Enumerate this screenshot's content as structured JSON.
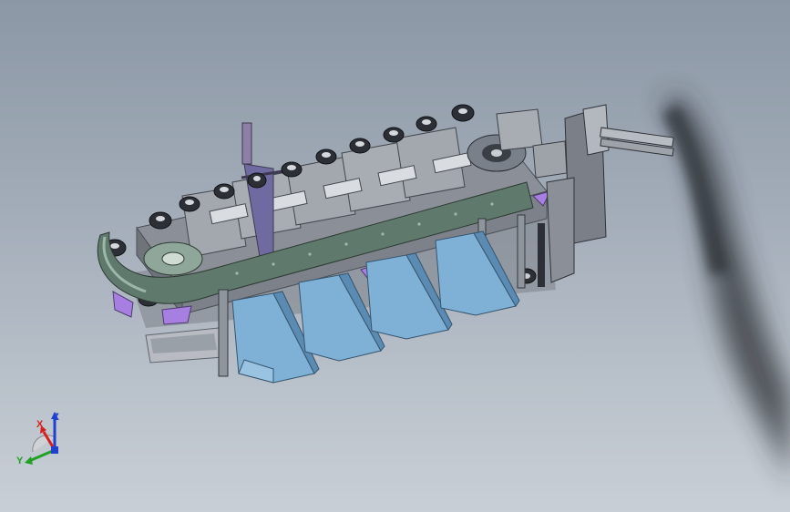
{
  "viewport": {
    "background_top": "#8c97a6",
    "background_bottom": "#c8cfd6"
  },
  "colors": {
    "frame": "#9aa0a8",
    "frame_dark": "#5e646c",
    "chain_plate": "#6e8a7c",
    "hopper": "#7fb0d6",
    "hopper_edge": "#35556e",
    "accent_purple": "#a77fe0",
    "shadow": "#2a2e33"
  },
  "triad": {
    "x_label": "X",
    "y_label": "Y",
    "z_label": "Z",
    "x_color": "#d42020",
    "y_color": "#22a022",
    "z_color": "#2040d0"
  }
}
